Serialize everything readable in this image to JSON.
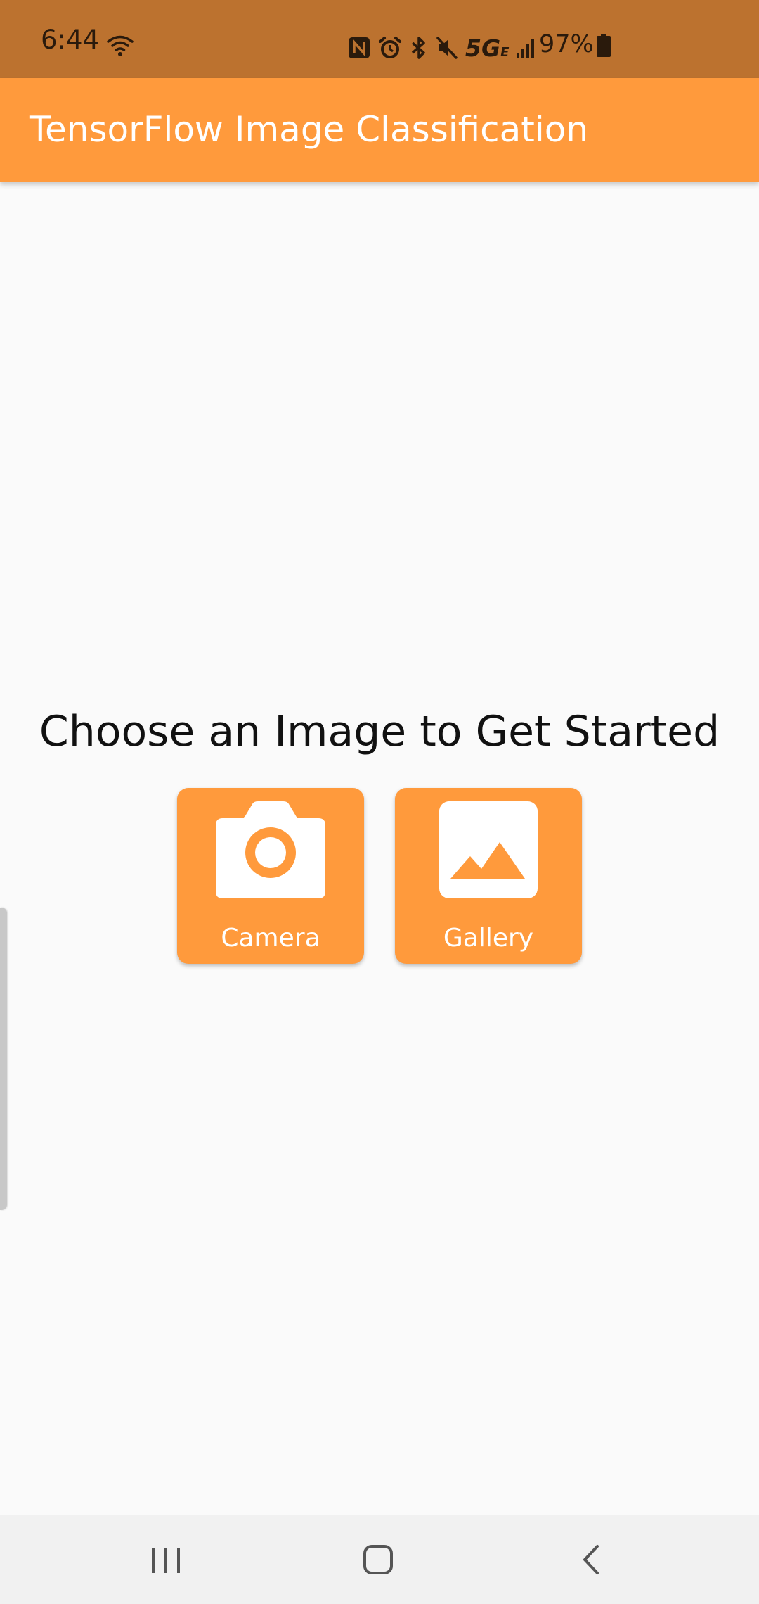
{
  "status_bar": {
    "time": "6:44",
    "network_label": "5G",
    "network_sub": "E",
    "battery": "97%",
    "icons": [
      "wifi-icon",
      "nfc-icon",
      "alarm-icon",
      "bluetooth-icon",
      "mute-icon",
      "5g-icon",
      "signal-icon",
      "battery-icon"
    ]
  },
  "app_bar": {
    "title": "TensorFlow Image Classification"
  },
  "main": {
    "prompt": "Choose an Image to Get Started",
    "buttons": [
      {
        "label": "Camera",
        "icon": "camera-icon"
      },
      {
        "label": "Gallery",
        "icon": "image-icon"
      }
    ]
  },
  "nav_bar": {
    "icons": [
      "recents-icon",
      "home-icon",
      "back-icon"
    ]
  },
  "colors": {
    "status_bar": "#BC722F",
    "app_bar": "#FF9A3C",
    "button": "#FF9A3C",
    "background": "#FAFAFA",
    "nav_bar": "#F1F1F1"
  }
}
